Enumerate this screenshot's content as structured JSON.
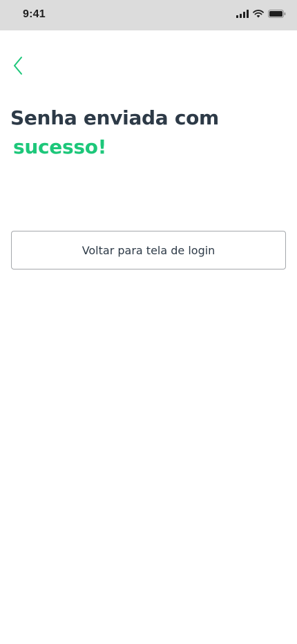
{
  "status_bar": {
    "time": "9:41",
    "icons": [
      "signal-icon",
      "wifi-icon",
      "battery-icon"
    ]
  },
  "nav": {
    "back_icon": "chevron-left-icon"
  },
  "header": {
    "title_line1": "Senha enviada com",
    "title_line2": "sucesso!"
  },
  "actions": {
    "login_button_label": "Voltar para tela de login"
  },
  "colors": {
    "accent": "#1dc77a",
    "text": "#2d3a47",
    "status_bar_bg": "#dcdcdc"
  }
}
